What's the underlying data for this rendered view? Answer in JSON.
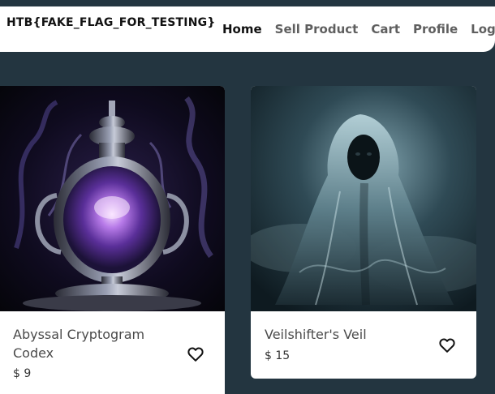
{
  "header": {
    "brand": "HTB{FAKE_FLAG_FOR_TESTING}",
    "nav": [
      "Home",
      "Sell Product",
      "Cart",
      "Profile",
      "Logout"
    ]
  },
  "products": [
    {
      "name": "Abyssal Cryptogram Codex",
      "price": "$ 9",
      "image": "glowing ornate purple vase"
    },
    {
      "name": "Veilshifter's Veil",
      "price": "$ 15",
      "image": "hooded spectral figure"
    }
  ]
}
